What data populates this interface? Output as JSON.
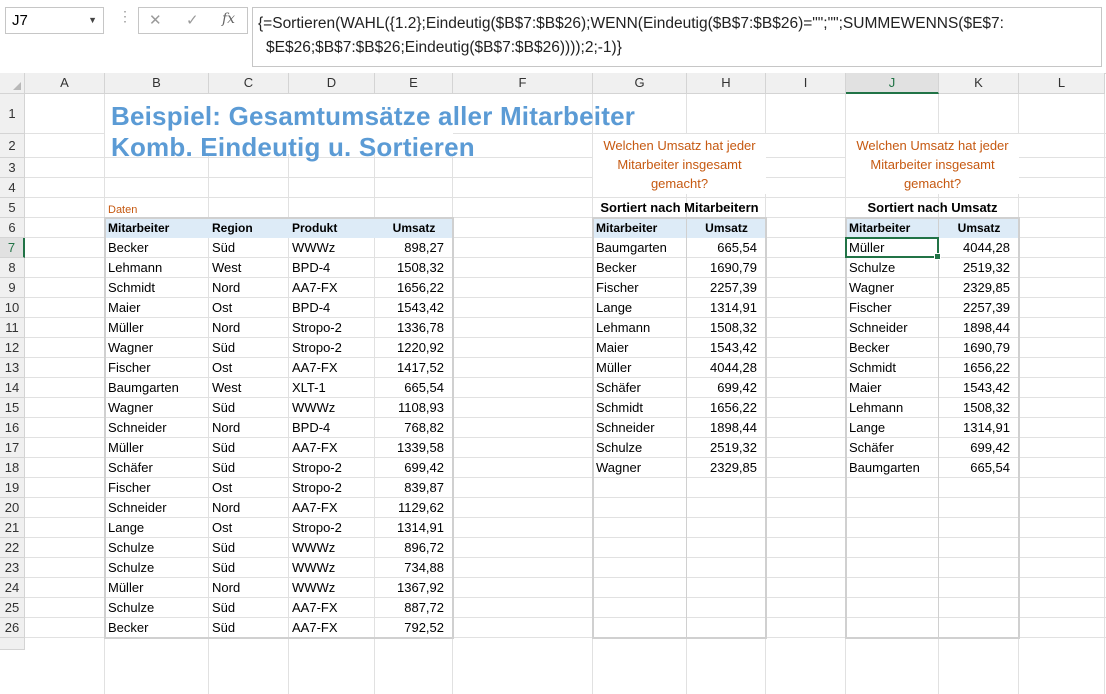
{
  "formula_bar": {
    "name_box": "J7",
    "cancel_icon": "✕",
    "confirm_icon": "✓",
    "fx_label": "fx",
    "formula_line1": "{=Sortieren(WAHL({1.2};Eindeutig($B$7:$B$26);WENN(Eindeutig($B$7:$B$26)=\"\";\"\";SUMMEWENNS($E$7:",
    "formula_line2": "$E$26;$B$7:$B$26;Eindeutig($B$7:$B$26))));2;-1)}"
  },
  "columns": [
    "A",
    "B",
    "C",
    "D",
    "E",
    "F",
    "G",
    "H",
    "I",
    "J",
    "K",
    "L"
  ],
  "rows": [
    "1",
    "2",
    "3",
    "4",
    "5",
    "6",
    "7",
    "8",
    "9",
    "10",
    "11",
    "12",
    "13",
    "14",
    "15",
    "16",
    "17",
    "18",
    "19",
    "20",
    "21",
    "22",
    "23",
    "24",
    "25",
    "26"
  ],
  "sheet": {
    "title1": "Beispiel: Gesamtumsätze aller Mitarbeiter",
    "title2": "Komb. Eindeutig u. Sortieren",
    "data_label": "Daten",
    "headers": [
      "Mitarbeiter",
      "Region",
      "Produkt",
      "Umsatz"
    ],
    "data": [
      [
        "Becker",
        "Süd",
        "WWWz",
        "898,27"
      ],
      [
        "Lehmann",
        "West",
        "BPD-4",
        "1508,32"
      ],
      [
        "Schmidt",
        "Nord",
        "AA7-FX",
        "1656,22"
      ],
      [
        "Maier",
        "Ost",
        "BPD-4",
        "1543,42"
      ],
      [
        "Müller",
        "Nord",
        "Stropo-2",
        "1336,78"
      ],
      [
        "Wagner",
        "Süd",
        "Stropo-2",
        "1220,92"
      ],
      [
        "Fischer",
        "Ost",
        "AA7-FX",
        "1417,52"
      ],
      [
        "Baumgarten",
        "West",
        "XLT-1",
        "665,54"
      ],
      [
        "Wagner",
        "Süd",
        "WWWz",
        "1108,93"
      ],
      [
        "Schneider",
        "Nord",
        "BPD-4",
        "768,82"
      ],
      [
        "Müller",
        "Süd",
        "AA7-FX",
        "1339,58"
      ],
      [
        "Schäfer",
        "Süd",
        "Stropo-2",
        "699,42"
      ],
      [
        "Fischer",
        "Ost",
        "Stropo-2",
        "839,87"
      ],
      [
        "Schneider",
        "Nord",
        "AA7-FX",
        "1129,62"
      ],
      [
        "Lange",
        "Ost",
        "Stropo-2",
        "1314,91"
      ],
      [
        "Schulze",
        "Süd",
        "WWWz",
        "896,72"
      ],
      [
        "Schulze",
        "Süd",
        "WWWz",
        "734,88"
      ],
      [
        "Müller",
        "Nord",
        "WWWz",
        "1367,92"
      ],
      [
        "Schulze",
        "Süd",
        "AA7-FX",
        "887,72"
      ],
      [
        "Becker",
        "Süd",
        "AA7-FX",
        "792,52"
      ]
    ],
    "question_line1": "Welchen Umsatz hat jeder",
    "question_line2": "Mitarbeiter insgesamt",
    "question_line3": "gemacht?",
    "sorted_by_name_title": "Sortiert nach Mitarbeitern",
    "sorted_by_sales_title": "Sortiert nach Umsatz",
    "result_headers": [
      "Mitarbeiter",
      "Umsatz"
    ],
    "sorted_by_name": [
      [
        "Baumgarten",
        "665,54"
      ],
      [
        "Becker",
        "1690,79"
      ],
      [
        "Fischer",
        "2257,39"
      ],
      [
        "Lange",
        "1314,91"
      ],
      [
        "Lehmann",
        "1508,32"
      ],
      [
        "Maier",
        "1543,42"
      ],
      [
        "Müller",
        "4044,28"
      ],
      [
        "Schäfer",
        "699,42"
      ],
      [
        "Schmidt",
        "1656,22"
      ],
      [
        "Schneider",
        "1898,44"
      ],
      [
        "Schulze",
        "2519,32"
      ],
      [
        "Wagner",
        "2329,85"
      ]
    ],
    "sorted_by_sales": [
      [
        "Müller",
        "4044,28"
      ],
      [
        "Schulze",
        "2519,32"
      ],
      [
        "Wagner",
        "2329,85"
      ],
      [
        "Fischer",
        "2257,39"
      ],
      [
        "Schneider",
        "1898,44"
      ],
      [
        "Becker",
        "1690,79"
      ],
      [
        "Schmidt",
        "1656,22"
      ],
      [
        "Maier",
        "1543,42"
      ],
      [
        "Lehmann",
        "1508,32"
      ],
      [
        "Lange",
        "1314,91"
      ],
      [
        "Schäfer",
        "699,42"
      ],
      [
        "Baumgarten",
        "665,54"
      ]
    ]
  },
  "colors": {
    "title": "#5b9bd5",
    "label_orange": "#c65911",
    "header_fill": "#ddebf7",
    "selection": "#217346"
  }
}
